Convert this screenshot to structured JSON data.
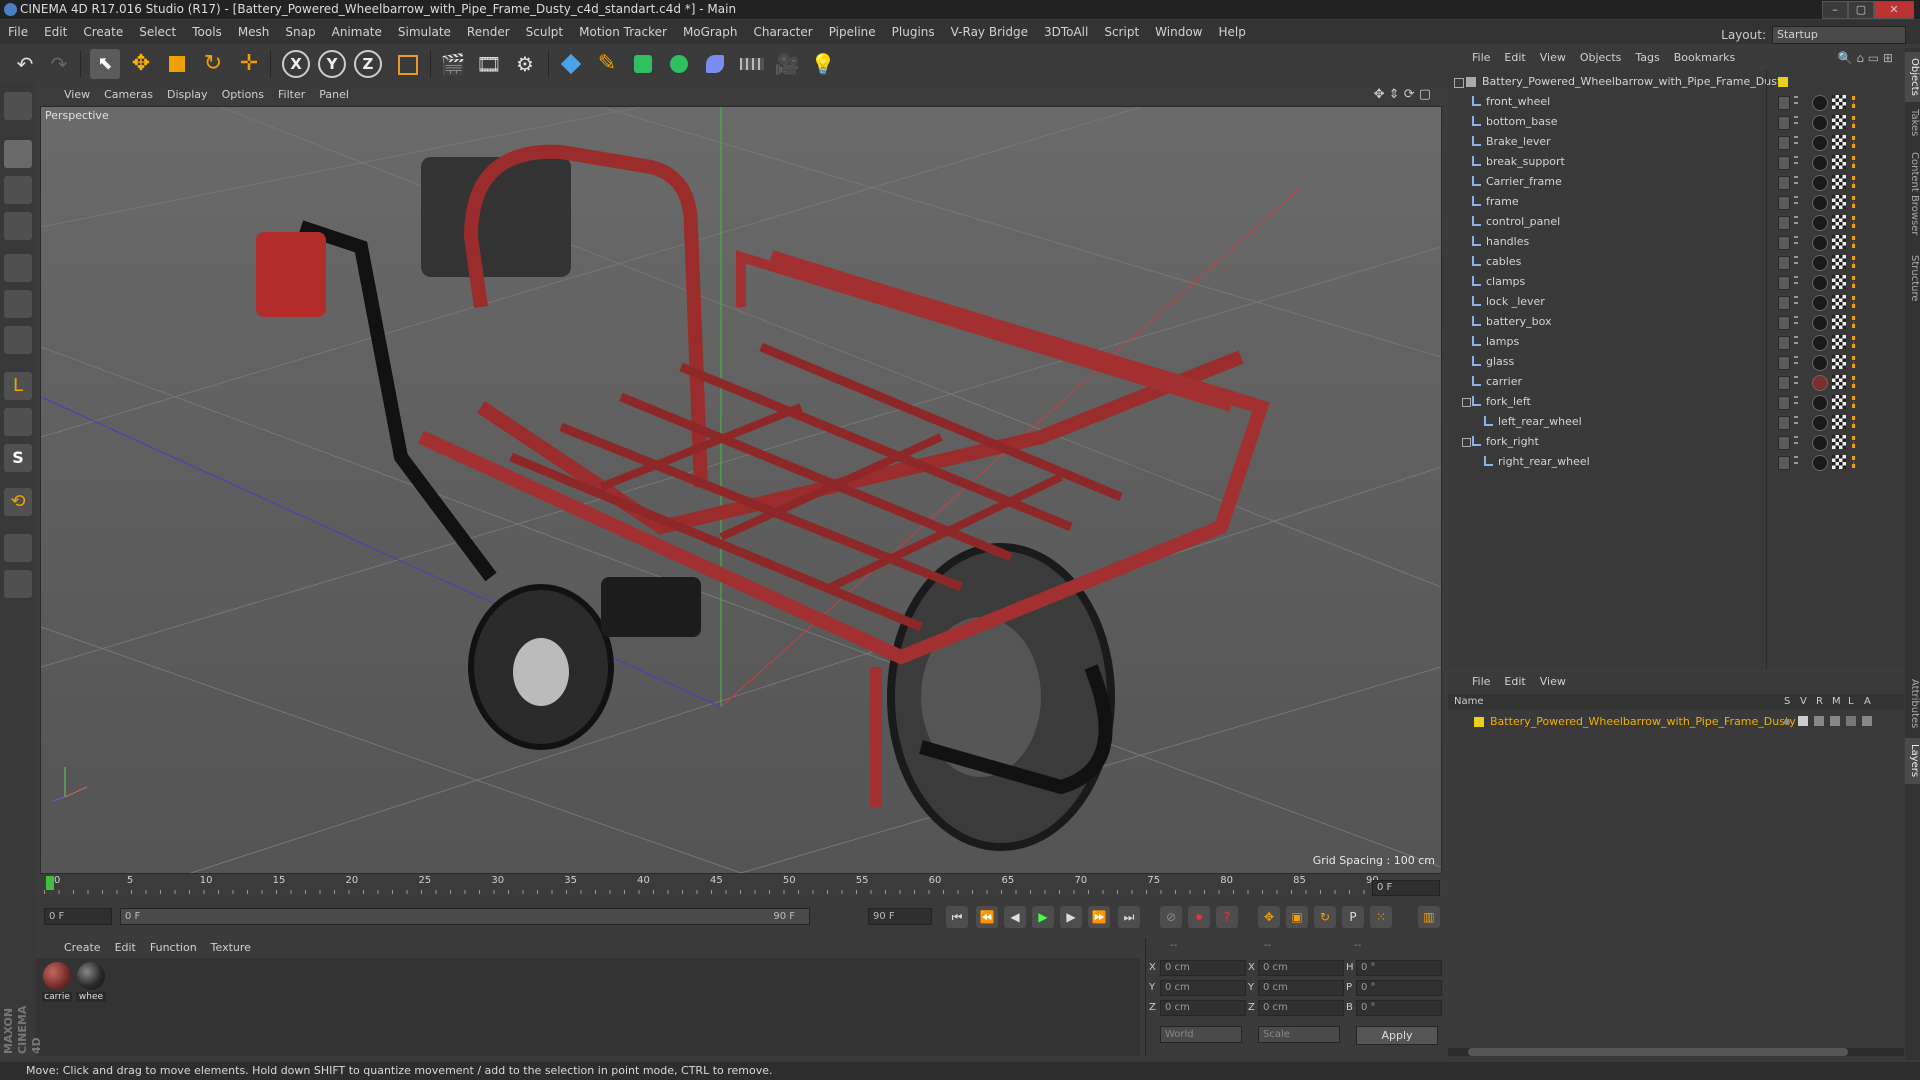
{
  "window": {
    "title": "CINEMA 4D R17.016 Studio (R17) - [Battery_Powered_Wheelbarrow_with_Pipe_Frame_Dusty_c4d_standart.c4d *] - Main"
  },
  "menubar": {
    "items": [
      "File",
      "Edit",
      "Create",
      "Select",
      "Tools",
      "Mesh",
      "Snap",
      "Animate",
      "Simulate",
      "Render",
      "Sculpt",
      "Motion Tracker",
      "MoGraph",
      "Character",
      "Pipeline",
      "Plugins",
      "V-Ray Bridge",
      "3DToAll",
      "Script",
      "Window",
      "Help"
    ],
    "layout_label": "Layout:",
    "layout_value": "Startup"
  },
  "toolbar": {
    "axis_x": "X",
    "axis_y": "Y",
    "axis_z": "Z"
  },
  "viewport": {
    "menu": [
      "View",
      "Cameras",
      "Display",
      "Options",
      "Filter",
      "Panel"
    ],
    "label": "Perspective",
    "grid_spacing": "Grid Spacing : 100 cm"
  },
  "timeline": {
    "ticks": [
      "0",
      "5",
      "10",
      "15",
      "20",
      "25",
      "30",
      "35",
      "40",
      "45",
      "50",
      "55",
      "60",
      "65",
      "70",
      "75",
      "80",
      "85",
      "90"
    ],
    "current_frame": "0 F",
    "start_field": "0 F",
    "range_start": "0 F",
    "range_end": "90 F",
    "end_field": "90 F"
  },
  "material_manager": {
    "menu": [
      "Create",
      "Edit",
      "Function",
      "Texture"
    ],
    "materials": [
      {
        "name": "carrie",
        "color": "#7a2f2b"
      },
      {
        "name": "whee",
        "color": "#2a2a2a"
      }
    ]
  },
  "coordinates": {
    "header": [
      "--",
      "--",
      "--"
    ],
    "rows": [
      {
        "a": "X",
        "av": "0 cm",
        "b": "X",
        "bv": "0 cm",
        "c": "H",
        "cv": "0 °"
      },
      {
        "a": "Y",
        "av": "0 cm",
        "b": "Y",
        "bv": "0 cm",
        "c": "P",
        "cv": "0 °"
      },
      {
        "a": "Z",
        "av": "0 cm",
        "b": "Z",
        "bv": "0 cm",
        "c": "B",
        "cv": "0 °"
      }
    ],
    "mode": "World",
    "scale": "Scale",
    "apply": "Apply"
  },
  "object_manager": {
    "menu": [
      "File",
      "Edit",
      "View",
      "Objects",
      "Tags",
      "Bookmarks"
    ],
    "root": "Battery_Powered_Wheelbarrow_with_Pipe_Frame_Dusty",
    "objects": [
      {
        "name": "front_wheel",
        "level": 1
      },
      {
        "name": "bottom_base",
        "level": 1
      },
      {
        "name": "Brake_lever",
        "level": 1
      },
      {
        "name": "break_support",
        "level": 1
      },
      {
        "name": "Carrier_frame",
        "level": 1
      },
      {
        "name": "frame",
        "level": 1
      },
      {
        "name": "control_panel",
        "level": 1
      },
      {
        "name": "handles",
        "level": 1
      },
      {
        "name": "cables",
        "level": 1
      },
      {
        "name": "clamps",
        "level": 1
      },
      {
        "name": "lock _lever",
        "level": 1
      },
      {
        "name": "battery_box",
        "level": 1
      },
      {
        "name": "lamps",
        "level": 1
      },
      {
        "name": "glass",
        "level": 1
      },
      {
        "name": "carrier",
        "level": 1
      },
      {
        "name": "fork_left",
        "level": 1
      },
      {
        "name": "left_rear_wheel",
        "level": 2
      },
      {
        "name": "fork_right",
        "level": 1
      },
      {
        "name": "right_rear_wheel",
        "level": 2
      }
    ]
  },
  "layer_manager": {
    "menu": [
      "File",
      "Edit",
      "View"
    ],
    "columns": {
      "name": "Name",
      "s": "S",
      "v": "V",
      "r": "R",
      "m": "M",
      "l": "L",
      "a": "A"
    },
    "layers": [
      "Battery_Powered_Wheelbarrow_with_Pipe_Frame_Dusty"
    ]
  },
  "side_tabs": [
    "Objects",
    "Takes",
    "Content Browser",
    "Structure",
    "Attributes",
    "Layers"
  ],
  "status": "Move: Click and drag to move elements. Hold down SHIFT to quantize movement / add to the selection in point mode, CTRL to remove.",
  "logo": {
    "line1": "MAXON",
    "line2": "CINEMA 4D"
  }
}
